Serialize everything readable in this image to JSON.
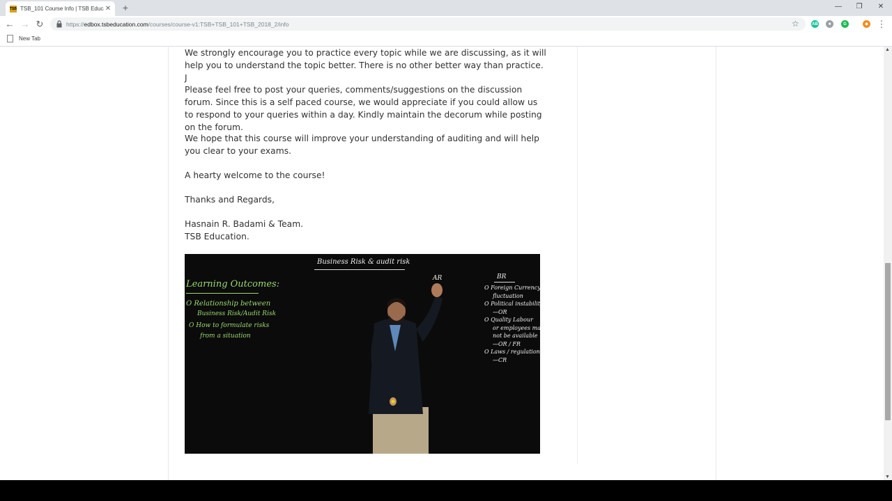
{
  "browser": {
    "tab_title": "TSB_101 Course Info | TSB Educa",
    "tab_favicon_text": "TSB",
    "tab_close": "✕",
    "new_tab": "+",
    "url_scheme": "https://",
    "url_host": "edbox.tsbeducation.com",
    "url_path": "/courses/course-v1:TSB+TSB_101+TSB_2018_2/info",
    "bookmark_label": "New Tab",
    "window_controls": {
      "minimize": "—",
      "restore": "❐",
      "close": "✕"
    },
    "nav": {
      "back": "←",
      "forward": "→",
      "reload": "↻",
      "star": "☆",
      "menu": "⋮"
    },
    "extensions": [
      {
        "name": "grammarly-extension-icon",
        "text": "AB",
        "color": "#15c39a"
      },
      {
        "name": "camera-extension-icon",
        "text": "■",
        "color": "#9aa0a6"
      },
      {
        "name": "g-extension-icon",
        "text": "G",
        "color": "#1db954"
      },
      {
        "name": "fox-extension-icon",
        "text": "◆",
        "color": "#f28b20"
      }
    ]
  },
  "course_info": {
    "paragraphs": [
      "We strongly encourage you to practice every topic while we are discussing, as it will help you to understand the topic better. There is no other better way than practice. J",
      "Please feel free to post your queries, comments/suggestions on the discussion forum. Since this is a self paced course, we would appreciate if you could allow us to respond to your queries within a day. Kindly maintain the decorum while posting on the forum.",
      "We hope that this course will improve your understanding of auditing and will help you clear to your exams.",
      "A hearty welcome to the course!",
      "Thanks and Regards,"
    ],
    "signature_name": "Hasnain R. Badami & Team.",
    "signature_org": "TSB Education."
  },
  "video": {
    "board_title": "Business Risk & audit risk",
    "learning_outcomes_heading": "Learning Outcomes:",
    "outcome_1_line1": "O Relationship between",
    "outcome_1_line2": "Business Risk/Audit Risk",
    "outcome_2_line1": "O How to formulate risks",
    "outcome_2_line2": "from a situation",
    "ar_label": "AR",
    "br_heading": "BR",
    "br_lines": [
      "O Foreign Currency",
      "fluctuation",
      "O Political instability",
      "—OR",
      "O Quality Labour",
      "or employees may",
      "not be available",
      "—OR / FR",
      "O Laws / regulations",
      "—CR"
    ],
    "colors": {
      "chalk": "#f0f0f0",
      "green": "#9bd96f",
      "background": "#0b0b0b"
    }
  }
}
